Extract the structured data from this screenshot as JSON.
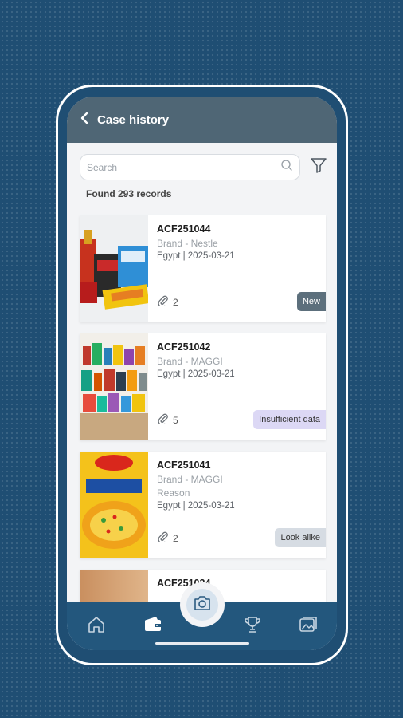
{
  "header": {
    "title": "Case history"
  },
  "search": {
    "placeholder": "Search"
  },
  "summary": {
    "found_text": "Found 293 records"
  },
  "cases": [
    {
      "id": "ACF251044",
      "brand": "Brand - Nestle",
      "reason": "",
      "meta": "Egypt | 2025-03-21",
      "attachments": "2",
      "status": "New",
      "image": "nestle-products"
    },
    {
      "id": "ACF251042",
      "brand": "Brand - MAGGI",
      "reason": "",
      "meta": "Egypt | 2025-03-21",
      "attachments": "5",
      "status": "Insufficient data",
      "image": "shelf-products"
    },
    {
      "id": "ACF251041",
      "brand": "Brand - MAGGI",
      "reason": "Reason",
      "meta": "Egypt | 2025-03-21",
      "attachments": "2",
      "status": "Look alike",
      "image": "maggi-noodles"
    },
    {
      "id": "ACF251034",
      "brand": "",
      "reason": "",
      "meta": "",
      "attachments": "",
      "status": "",
      "image": "wood-texture"
    }
  ],
  "nav": {
    "items": [
      "home-icon",
      "wallet-icon",
      "camera-icon",
      "trophy-icon",
      "gallery-icon"
    ],
    "active": "camera-icon"
  },
  "colors": {
    "background": "#1f4e73",
    "appbar": "#4f6675",
    "navbar": "#23577d",
    "badge_new": "#5c6f7c",
    "badge_insufficient": "#dcd8f5",
    "badge_look_alike": "#d6dce3"
  }
}
